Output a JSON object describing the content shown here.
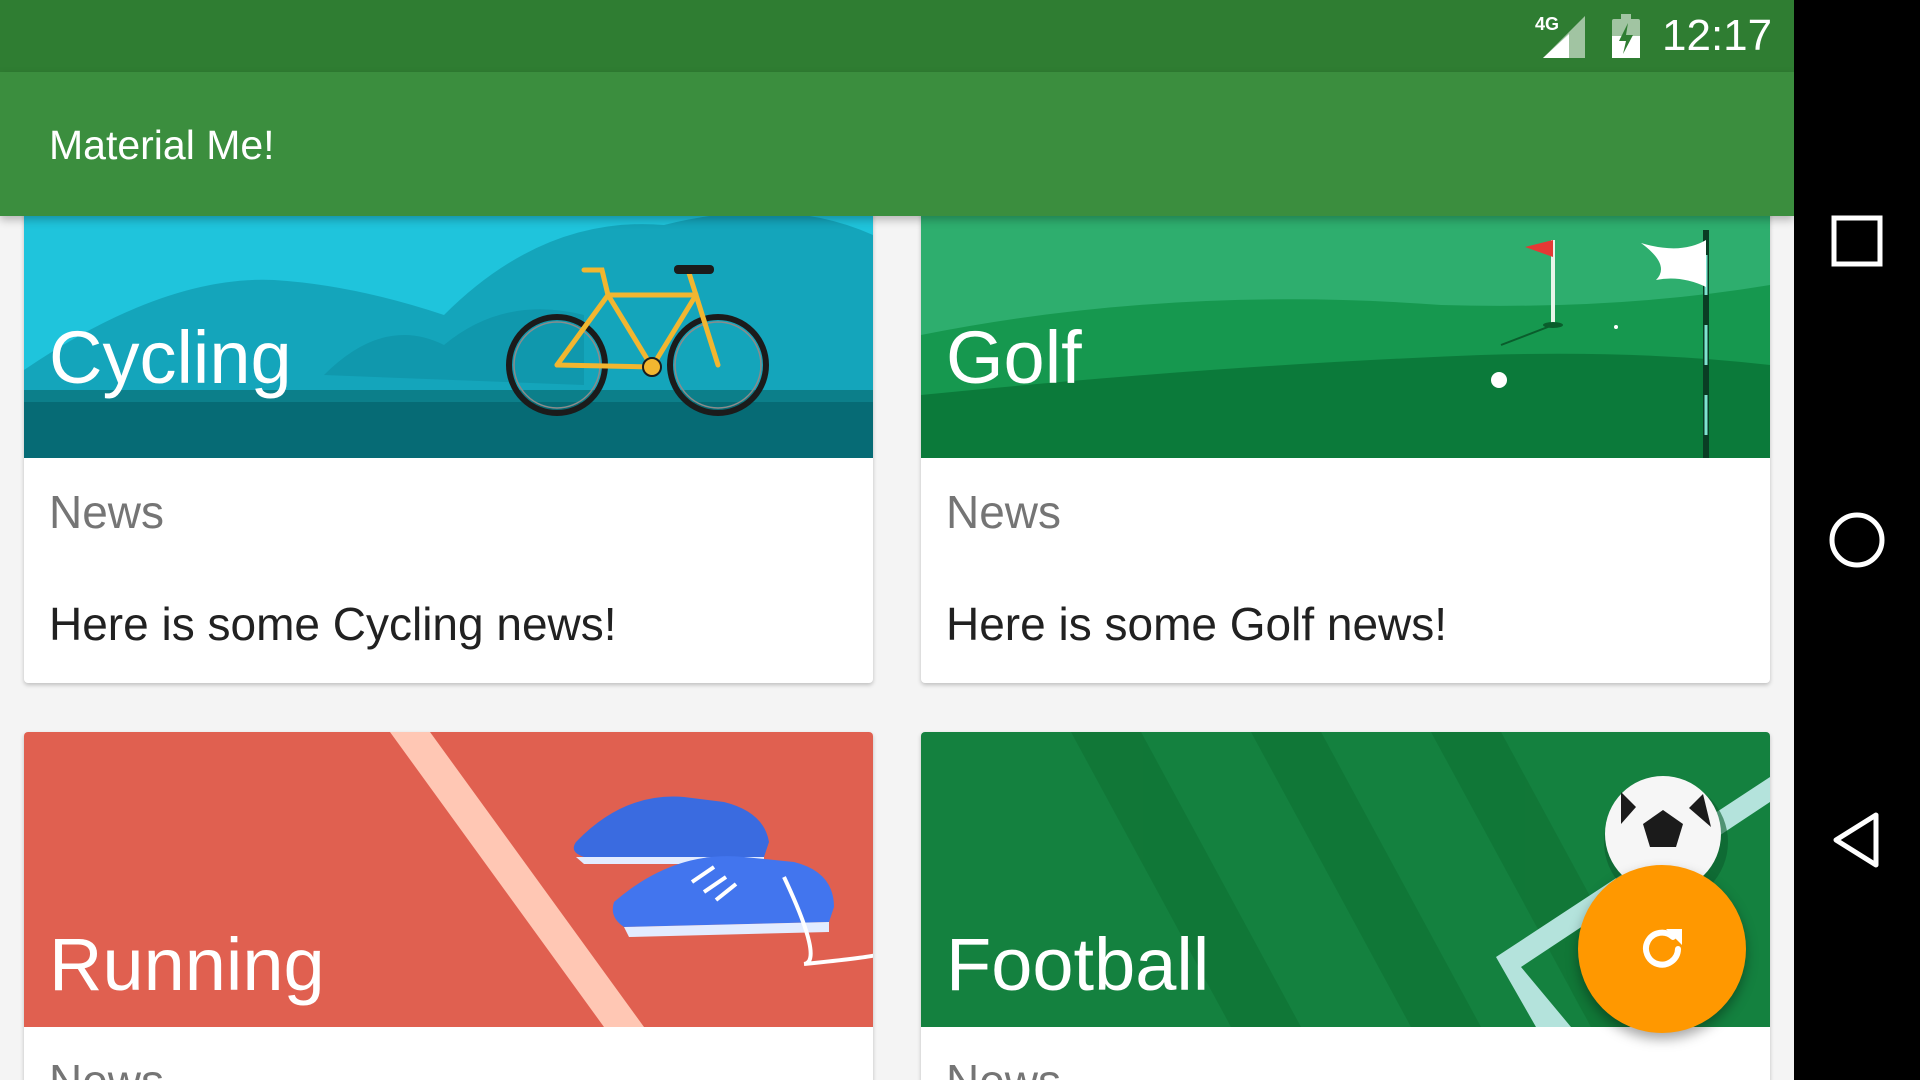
{
  "status_bar": {
    "network": "4G",
    "time": "12:17",
    "signal_icon": "signal-icon",
    "battery_icon": "battery-charging-icon"
  },
  "app_bar": {
    "title": "Material Me!"
  },
  "cards": [
    {
      "title": "Cycling",
      "subtitle": "News",
      "text": "Here is some Cycling news!"
    },
    {
      "title": "Golf",
      "subtitle": "News",
      "text": "Here is some Golf news!"
    },
    {
      "title": "Running",
      "subtitle": "News"
    },
    {
      "title": "Football",
      "subtitle": "News"
    }
  ],
  "fab": {
    "icon": "refresh-icon"
  },
  "nav_bar": {
    "icons": [
      "recents-icon",
      "home-icon",
      "back-icon"
    ]
  },
  "colors": {
    "status_bar": "#2f7d32",
    "app_bar": "#3b8e3e",
    "fab": "#ff9800",
    "cycling": "#1fc4dc",
    "golf": "#0d8a43",
    "running": "#e06050",
    "football": "#14813f"
  }
}
